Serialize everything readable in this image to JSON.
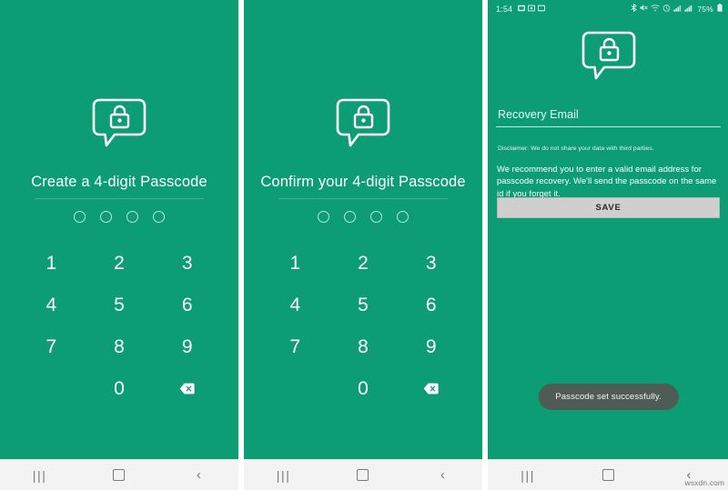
{
  "theme": {
    "brand_green": "#0d9d74",
    "navbar_bg": "#f3f3f3",
    "save_button_bg": "#cfcfcf",
    "toast_bg": "#4f5b55",
    "text_on_green": "#ffffff"
  },
  "panels": {
    "create": {
      "icon": "lock-chat-bubble-icon",
      "title": "Create a 4-digit Passcode",
      "dots": [
        "",
        "",
        "",
        ""
      ],
      "keypad": [
        {
          "label": "1",
          "name": "keypad-key-1"
        },
        {
          "label": "2",
          "name": "keypad-key-2"
        },
        {
          "label": "3",
          "name": "keypad-key-3"
        },
        {
          "label": "4",
          "name": "keypad-key-4"
        },
        {
          "label": "5",
          "name": "keypad-key-5"
        },
        {
          "label": "6",
          "name": "keypad-key-6"
        },
        {
          "label": "7",
          "name": "keypad-key-7"
        },
        {
          "label": "8",
          "name": "keypad-key-8"
        },
        {
          "label": "9",
          "name": "keypad-key-9"
        },
        {
          "label": "",
          "name": "keypad-key-blank"
        },
        {
          "label": "0",
          "name": "keypad-key-0"
        },
        {
          "label": "",
          "name": "keypad-key-backspace"
        }
      ]
    },
    "confirm": {
      "icon": "lock-chat-bubble-icon",
      "title": "Confirm your 4-digit Passcode",
      "dots": [
        "",
        "",
        "",
        ""
      ],
      "keypad": [
        {
          "label": "1",
          "name": "keypad-key-1"
        },
        {
          "label": "2",
          "name": "keypad-key-2"
        },
        {
          "label": "3",
          "name": "keypad-key-3"
        },
        {
          "label": "4",
          "name": "keypad-key-4"
        },
        {
          "label": "5",
          "name": "keypad-key-5"
        },
        {
          "label": "6",
          "name": "keypad-key-6"
        },
        {
          "label": "7",
          "name": "keypad-key-7"
        },
        {
          "label": "8",
          "name": "keypad-key-8"
        },
        {
          "label": "9",
          "name": "keypad-key-9"
        },
        {
          "label": "",
          "name": "keypad-key-blank"
        },
        {
          "label": "0",
          "name": "keypad-key-0"
        },
        {
          "label": "",
          "name": "keypad-key-backspace"
        }
      ]
    },
    "recovery": {
      "statusbar": {
        "time": "1:54",
        "left_icons": [
          "screenshot-icon",
          "gallery-icon",
          "cast-icon"
        ],
        "right_icons": [
          "bluetooth-icon",
          "mute-icon",
          "wifi-icon",
          "data-saver-icon",
          "signal-sim1-icon",
          "signal-sim2-icon"
        ],
        "battery_percent": "75%",
        "battery_icon": "battery-icon"
      },
      "icon": "lock-chat-bubble-icon",
      "email_field": {
        "placeholder": "Recovery Email",
        "value": ""
      },
      "disclaimer": "Disclaimer: We do not share your data with third parties.",
      "recommendation": "We recommend you to enter a valid email address for passcode recovery. We'll send the passcode on the same id if you forget it.",
      "save_label": "SAVE",
      "toast": "Passcode set successfully."
    }
  },
  "navbar": {
    "recents_label": "|||",
    "home_label": "",
    "back_label": "‹",
    "items": [
      {
        "name": "nav-recents-button",
        "icon": "recents-icon"
      },
      {
        "name": "nav-home-button",
        "icon": "home-icon"
      },
      {
        "name": "nav-back-button",
        "icon": "back-icon"
      }
    ]
  },
  "watermark": "wsxdn.com"
}
